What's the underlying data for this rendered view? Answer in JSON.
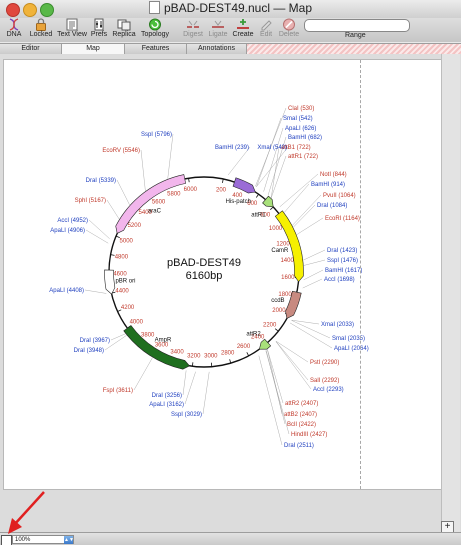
{
  "window": {
    "title": "pBAD-DEST49.nucl — Map"
  },
  "toolbar": {
    "items": [
      {
        "label": "DNA",
        "icon": "dna-icon",
        "enabled": true
      },
      {
        "label": "Locked",
        "icon": "lock-icon",
        "enabled": true
      },
      {
        "label": "Text View",
        "icon": "text-view-icon",
        "enabled": true
      },
      {
        "label": "Prefs",
        "icon": "prefs-icon",
        "enabled": true
      },
      {
        "label": "Replica",
        "icon": "replica-icon",
        "enabled": true
      },
      {
        "label": "Topology",
        "icon": "topology-icon",
        "enabled": true
      },
      {
        "label": "Digest",
        "icon": "digest-icon",
        "enabled": false
      },
      {
        "label": "Ligate",
        "icon": "ligate-icon",
        "enabled": false
      },
      {
        "label": "Create",
        "icon": "create-icon",
        "enabled": true
      },
      {
        "label": "Edit",
        "icon": "edit-icon",
        "enabled": false
      },
      {
        "label": "Delete",
        "icon": "delete-icon",
        "enabled": false
      }
    ],
    "range_label": "Range",
    "range_value": ""
  },
  "tabs": [
    {
      "label": "Editor",
      "active": false
    },
    {
      "label": "Map",
      "active": true
    },
    {
      "label": "Features",
      "active": false
    },
    {
      "label": "Annotations",
      "active": false
    }
  ],
  "map": {
    "name": "pBAD-DEST49",
    "length_label": "6160bp",
    "ticks": [
      "200",
      "400",
      "600",
      "800",
      "1000",
      "1200",
      "1400",
      "1600",
      "1800",
      "2000",
      "2200",
      "2400",
      "2600",
      "2800",
      "3000",
      "3200",
      "3400",
      "3600",
      "3800",
      "4000",
      "4200",
      "4400",
      "4600",
      "4800",
      "5000",
      "5200",
      "5400",
      "5600",
      "5800",
      "6000"
    ],
    "features": [
      {
        "label": "araC",
        "color": "#f2b6ec"
      },
      {
        "label": "His-patch",
        "color": "#9a6bd6"
      },
      {
        "label": "attR1",
        "color": "#a8e07a"
      },
      {
        "label": "CamR",
        "color": "#f6f000"
      },
      {
        "label": "ccdB",
        "color": "#c88a80"
      },
      {
        "label": "attR2",
        "color": "#a8e07a"
      },
      {
        "label": "AmpR",
        "color": "#1f6f1f"
      },
      {
        "label": "pBR ori",
        "color": "#ffffff"
      }
    ],
    "sites_right": [
      {
        "label": "ClaI (530)",
        "color": "#c0392b"
      },
      {
        "label": "SmaI (542)",
        "color": "#1f3fbf"
      },
      {
        "label": "ApaLI (626)",
        "color": "#1f3fbf"
      },
      {
        "label": "BamHI (682)",
        "color": "#1f3fbf"
      },
      {
        "label": "attB1 (722)",
        "color": "#c0392b"
      },
      {
        "label": "attR1 (722)",
        "color": "#c0392b"
      },
      {
        "label": "NotI (844)",
        "color": "#c0392b"
      },
      {
        "label": "BamHI (914)",
        "color": "#1f3fbf"
      },
      {
        "label": "PvuII (1064)",
        "color": "#c0392b"
      },
      {
        "label": "DraI (1084)",
        "color": "#1f3fbf"
      },
      {
        "label": "EcoRI (1164)",
        "color": "#c0392b"
      },
      {
        "label": "DraI (1423)",
        "color": "#1f3fbf"
      },
      {
        "label": "SspI (1476)",
        "color": "#1f3fbf"
      },
      {
        "label": "BamHI (1617)",
        "color": "#1f3fbf"
      },
      {
        "label": "AccI (1698)",
        "color": "#1f3fbf"
      },
      {
        "label": "XmaI (2033)",
        "color": "#1f3fbf"
      },
      {
        "label": "SmaI (2035)",
        "color": "#1f3fbf"
      },
      {
        "label": "ApaLI (2064)",
        "color": "#1f3fbf"
      },
      {
        "label": "PstI (2290)",
        "color": "#c0392b"
      },
      {
        "label": "SalI (2292)",
        "color": "#c0392b"
      },
      {
        "label": "AccI (2293)",
        "color": "#1f3fbf"
      },
      {
        "label": "attR2 (2407)",
        "color": "#c0392b"
      },
      {
        "label": "attB2 (2407)",
        "color": "#c0392b"
      },
      {
        "label": "BclI (2422)",
        "color": "#c0392b"
      },
      {
        "label": "HindIII (2427)",
        "color": "#c0392b"
      },
      {
        "label": "DraI (2511)",
        "color": "#1f3fbf"
      }
    ],
    "sites_left": [
      {
        "label": "SspI (5796)",
        "color": "#1f3fbf"
      },
      {
        "label": "BamHI (239)",
        "color": "#1f3fbf"
      },
      {
        "label": "XmaI (540)",
        "color": "#1f3fbf"
      },
      {
        "label": "EcoRV (5546)",
        "color": "#c0392b"
      },
      {
        "label": "DraI (5339)",
        "color": "#1f3fbf"
      },
      {
        "label": "SphI (5167)",
        "color": "#c0392b"
      },
      {
        "label": "AccI (4952)",
        "color": "#1f3fbf"
      },
      {
        "label": "ApaLI (4906)",
        "color": "#1f3fbf"
      },
      {
        "label": "ApaLI (4408)",
        "color": "#1f3fbf"
      },
      {
        "label": "DraI (3967)",
        "color": "#1f3fbf"
      },
      {
        "label": "DraI (3948)",
        "color": "#1f3fbf"
      },
      {
        "label": "FspI (3611)",
        "color": "#c0392b"
      },
      {
        "label": "DraI (3256)",
        "color": "#1f3fbf"
      },
      {
        "label": "ApaLI (3162)",
        "color": "#1f3fbf"
      },
      {
        "label": "SspI (3029)",
        "color": "#1f3fbf"
      }
    ]
  },
  "statusbar": {
    "zoom": "100%"
  }
}
